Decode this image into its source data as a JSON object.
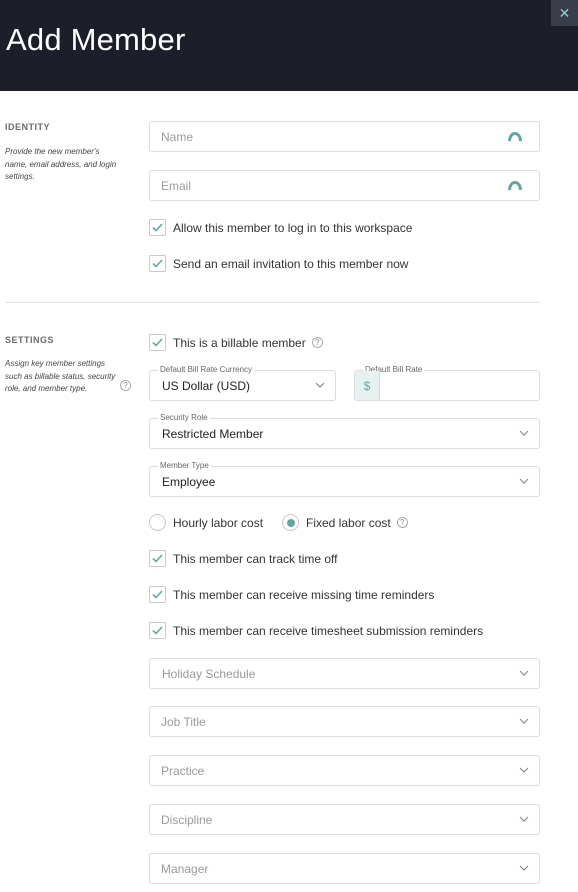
{
  "header": {
    "title": "Add Member",
    "close_glyph": "✕"
  },
  "identity": {
    "section_title": "IDENTITY",
    "description": "Provide the new member's name, email address, and login settings.",
    "name_placeholder": "Name",
    "email_placeholder": "Email",
    "allow_login_label": "Allow this member to log in to this workspace",
    "allow_login_checked": true,
    "send_invite_label": "Send an email invitation to this member now",
    "send_invite_checked": true
  },
  "settings": {
    "section_title": "SETTINGS",
    "description": "Assign key member settings such as billable status, security role, and member type.",
    "billable_label": "This is a billable member",
    "billable_checked": true,
    "currency_label": "Default Bill Rate Currency",
    "currency_value": "US Dollar (USD)",
    "bill_rate_label": "Default Bill Rate",
    "bill_rate_prefix": "$",
    "bill_rate_value": "",
    "security_role_label": "Security Role",
    "security_role_value": "Restricted Member",
    "member_type_label": "Member Type",
    "member_type_value": "Employee",
    "labor_cost_options": [
      "Hourly labor cost",
      "Fixed labor cost"
    ],
    "labor_cost_selected": "Fixed labor cost",
    "track_time_off_label": "This member can track time off",
    "missing_time_label": "This member can receive missing time reminders",
    "timesheet_reminder_label": "This member can receive timesheet submission reminders",
    "holiday_schedule_placeholder": "Holiday Schedule",
    "job_title_placeholder": "Job Title",
    "practice_placeholder": "Practice",
    "discipline_placeholder": "Discipline",
    "manager_placeholder": "Manager"
  },
  "colors": {
    "header_bg": "#1c1f29",
    "accent": "#5fa8a0"
  },
  "icons": {
    "help": "question-circle-icon",
    "check": "check-icon",
    "chevron": "chevron-down-icon",
    "field_status": "teal-arc-icon"
  }
}
